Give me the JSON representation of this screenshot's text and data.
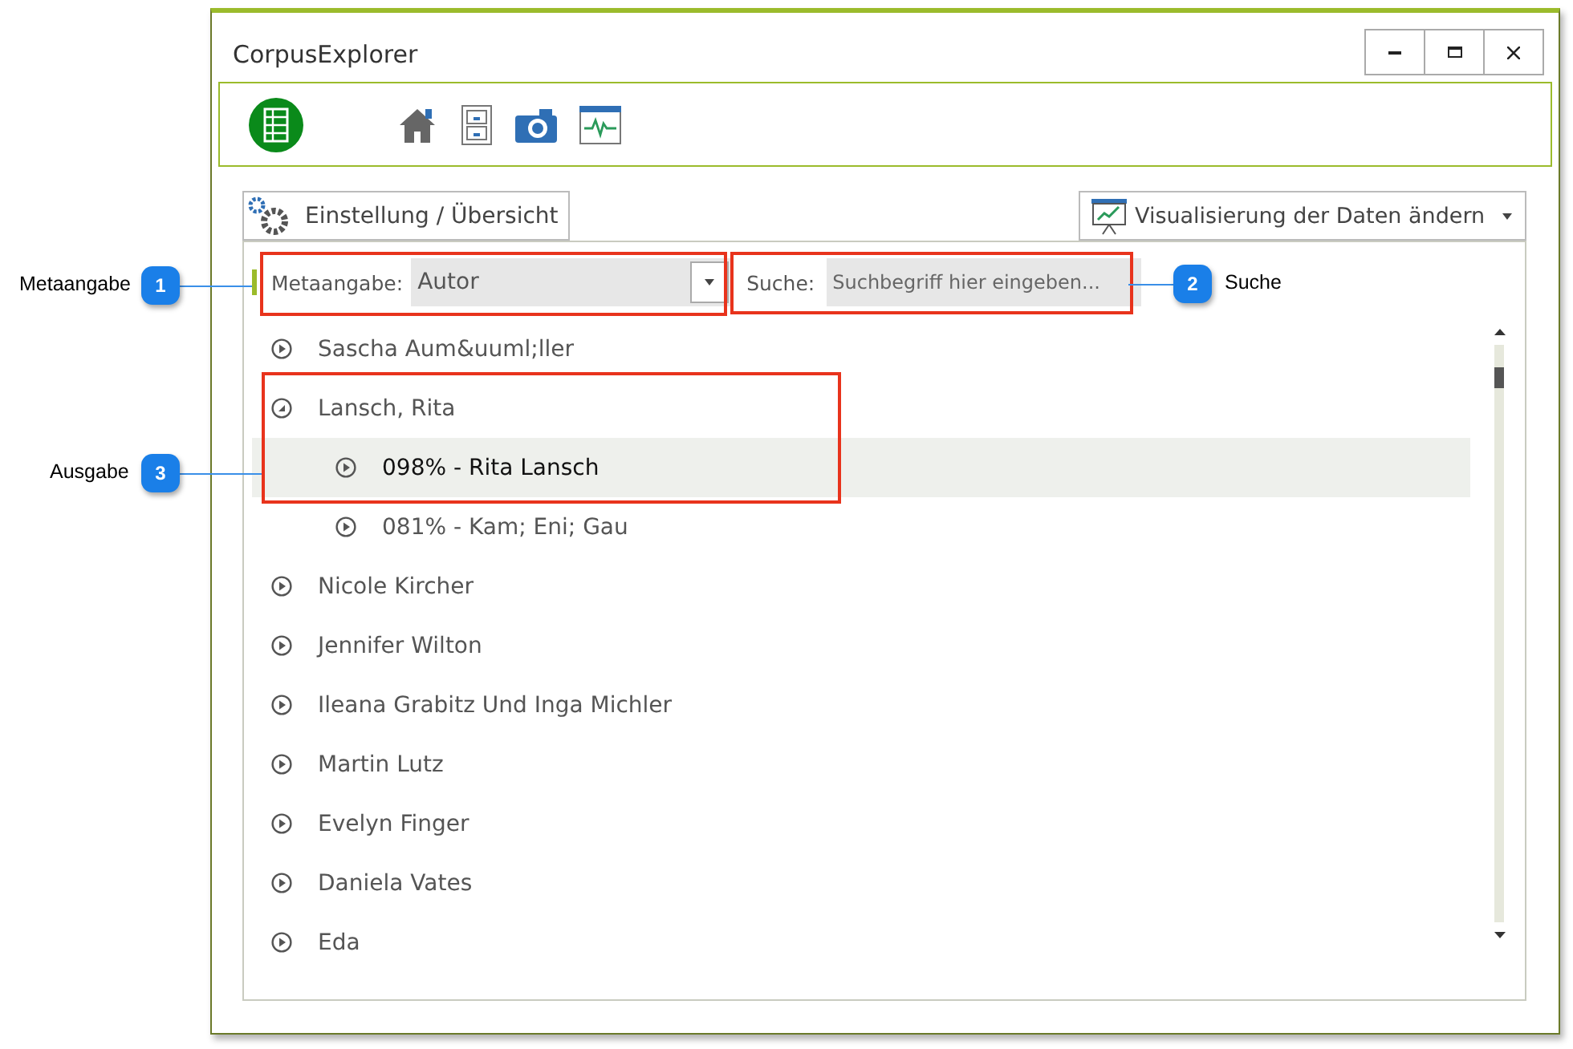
{
  "window": {
    "title": "CorpusExplorer"
  },
  "settings_tab": {
    "label": "Einstellung / Übersicht"
  },
  "view_dropdown": {
    "label": "Visualisierung der Daten ändern"
  },
  "filter": {
    "meta_label": "Metaangabe:",
    "meta_value": "Autor",
    "search_label": "Suche:",
    "search_placeholder": "Suchbegriff hier eingeben..."
  },
  "tree": [
    {
      "label": "Sascha Aum&uuml;ller",
      "expanded": false,
      "selected": false
    },
    {
      "label": "Lansch, Rita",
      "expanded": true,
      "selected": false,
      "children": [
        {
          "label": "098% - Rita Lansch",
          "expanded": false,
          "selected": true
        },
        {
          "label": "081% - Kam; Eni; Gau",
          "expanded": false,
          "selected": false
        }
      ]
    },
    {
      "label": "Nicole Kircher",
      "expanded": false,
      "selected": false
    },
    {
      "label": "Jennifer Wilton",
      "expanded": false,
      "selected": false
    },
    {
      "label": "Ileana Grabitz Und Inga Michler",
      "expanded": false,
      "selected": false
    },
    {
      "label": "Martin Lutz",
      "expanded": false,
      "selected": false
    },
    {
      "label": "Evelyn Finger",
      "expanded": false,
      "selected": false
    },
    {
      "label": "Daniela Vates",
      "expanded": false,
      "selected": false
    },
    {
      "label": "Eda",
      "expanded": false,
      "selected": false
    }
  ],
  "callouts": [
    {
      "number": "1",
      "label": "Metaangabe"
    },
    {
      "number": "2",
      "label": "Suche"
    },
    {
      "number": "3",
      "label": "Ausgabe"
    }
  ]
}
